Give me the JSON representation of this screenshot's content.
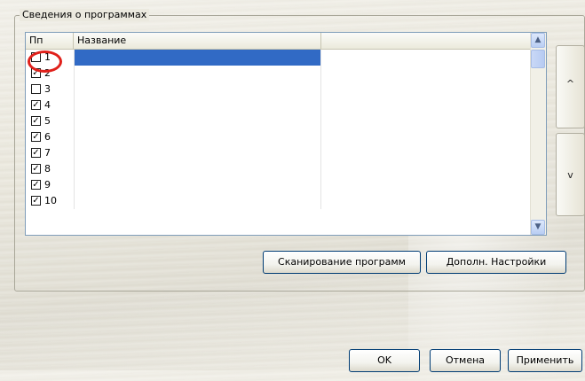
{
  "group": {
    "title": "Сведения о программах"
  },
  "table": {
    "columns": [
      "Пп",
      "Название"
    ],
    "rows": [
      {
        "num": "1",
        "checked": false,
        "selected": true
      },
      {
        "num": "2",
        "checked": true,
        "selected": false
      },
      {
        "num": "3",
        "checked": false,
        "selected": false
      },
      {
        "num": "4",
        "checked": true,
        "selected": false
      },
      {
        "num": "5",
        "checked": true,
        "selected": false
      },
      {
        "num": "6",
        "checked": true,
        "selected": false
      },
      {
        "num": "7",
        "checked": true,
        "selected": false
      },
      {
        "num": "8",
        "checked": true,
        "selected": false
      },
      {
        "num": "9",
        "checked": true,
        "selected": false
      },
      {
        "num": "10",
        "checked": true,
        "selected": false
      }
    ]
  },
  "side": {
    "up_label": "^",
    "down_label": "v"
  },
  "buttons": {
    "scan": "Сканирование программ",
    "advanced": "Дополн. Настройки",
    "ok": "OK",
    "cancel": "Отмена",
    "apply": "Применить"
  },
  "colors": {
    "selection": "#316ac5",
    "highlight_ring": "#e0201a",
    "button_border": "#003c74"
  }
}
